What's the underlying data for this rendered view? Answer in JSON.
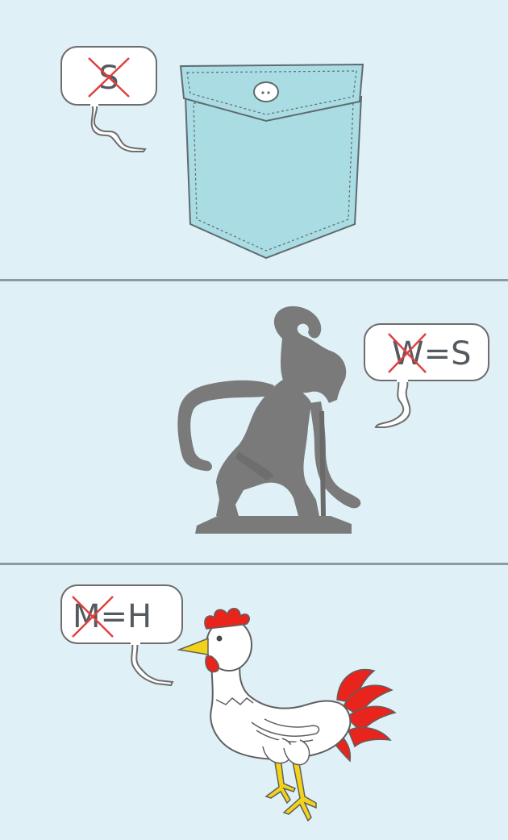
{
  "colors": {
    "background": "#e0f0f7",
    "divider": "#8c9aa2",
    "pocket": "#aadce3",
    "puppet": "#7a7a7a",
    "cross": "#e04040",
    "comb": "#e8241c",
    "beak": "#f2d21a"
  },
  "panels": [
    {
      "bubble": {
        "crossed_letter": "S",
        "suffix": ""
      },
      "icon": "shirt-pocket-icon"
    },
    {
      "bubble": {
        "crossed_letter": "W",
        "suffix": "=S"
      },
      "icon": "shadow-puppet-icon"
    },
    {
      "bubble": {
        "crossed_letter": "M",
        "suffix": "=H"
      },
      "icon": "rooster-icon"
    }
  ]
}
